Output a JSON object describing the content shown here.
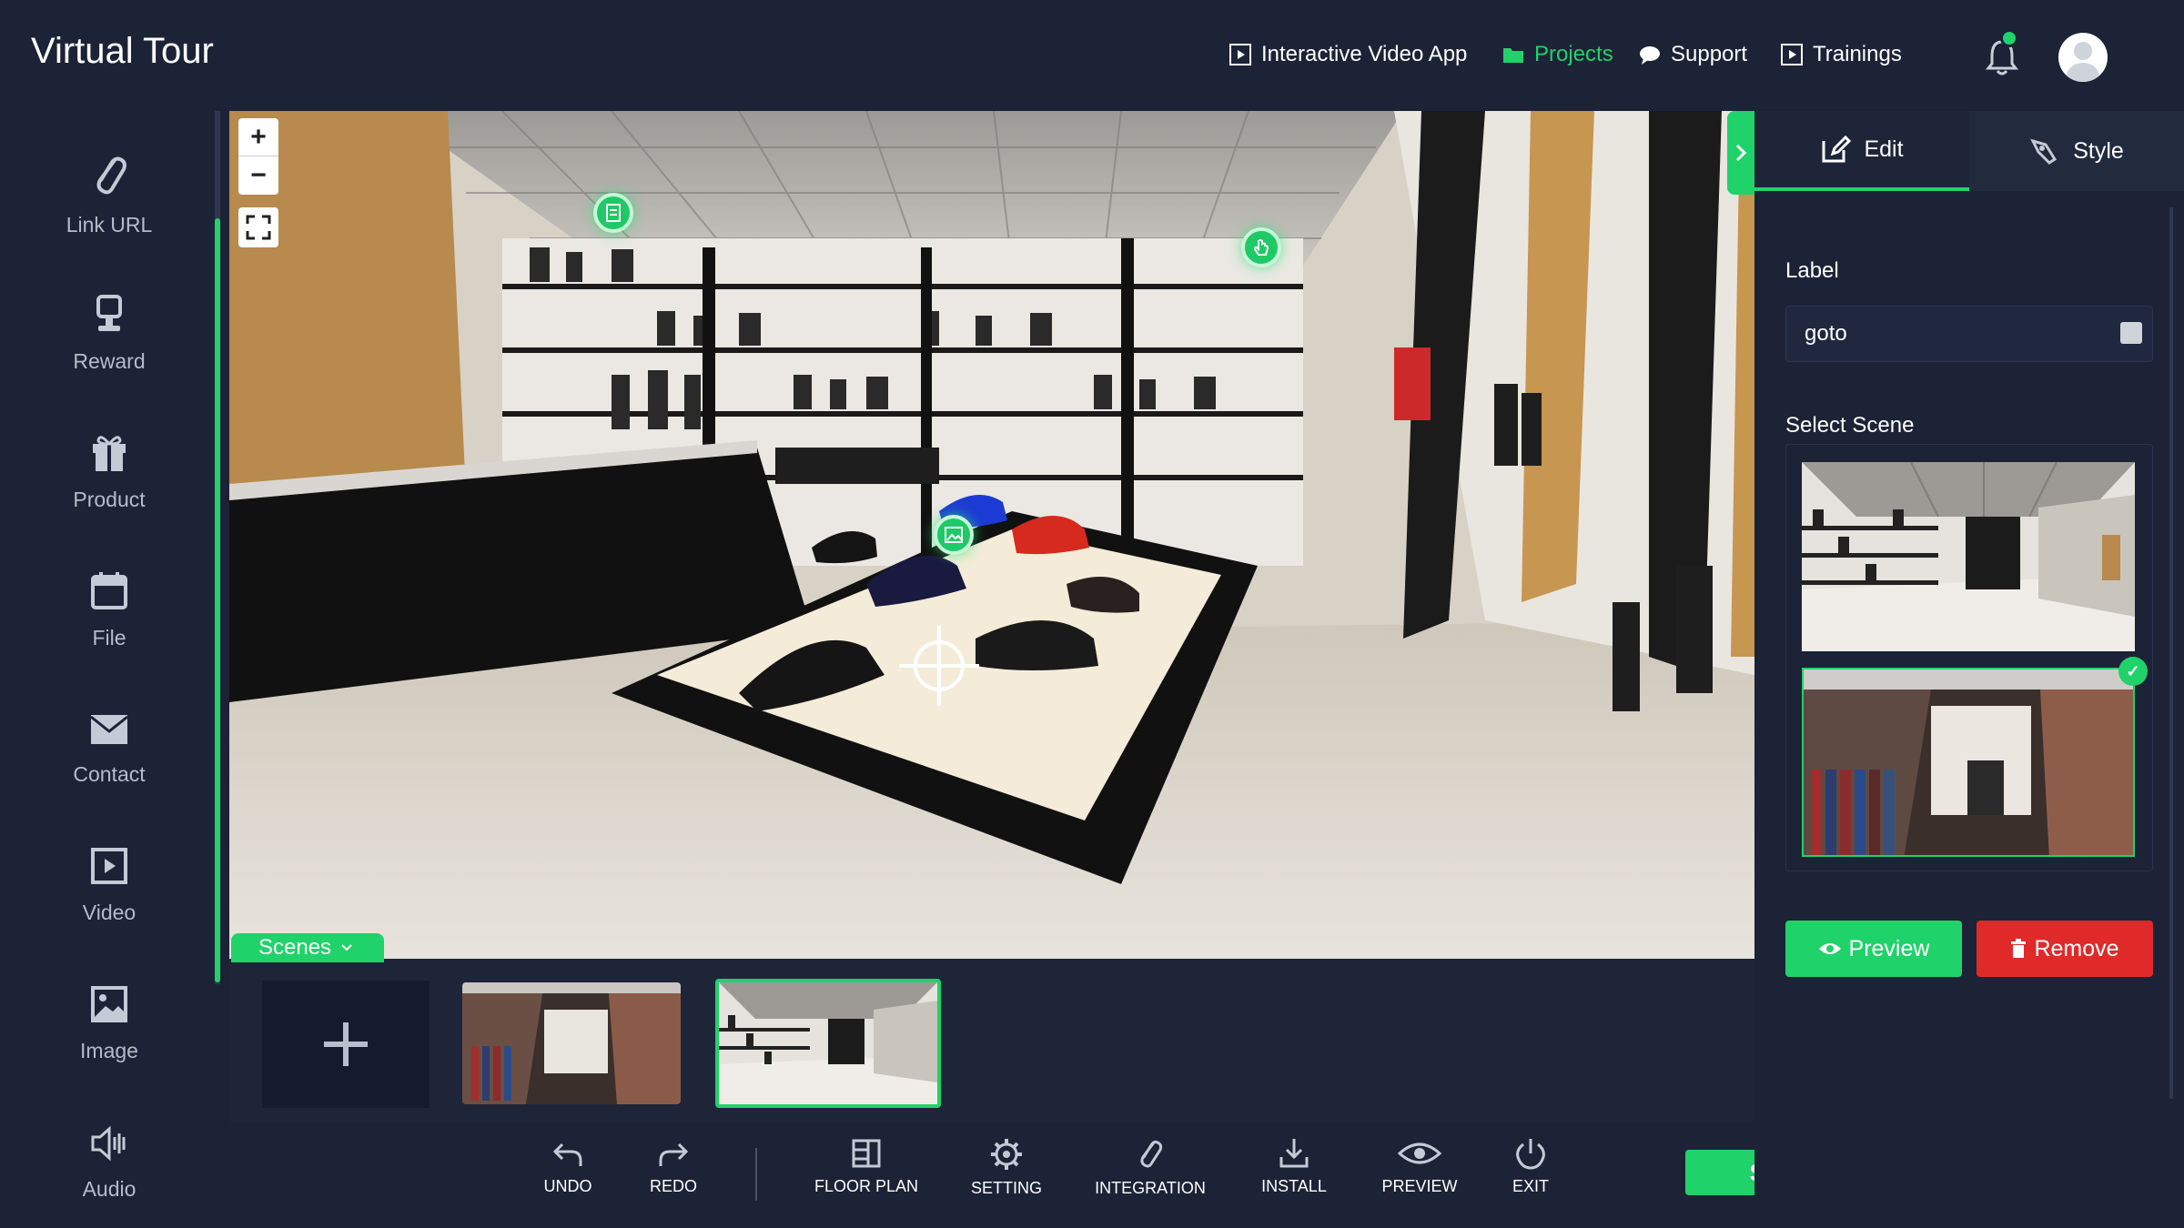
{
  "app": {
    "title": "Virtual Tour"
  },
  "topnav": {
    "items": [
      {
        "label": "Interactive Video App",
        "icon": "play-square-icon",
        "active": false
      },
      {
        "label": "Projects",
        "icon": "folder-icon",
        "active": true
      },
      {
        "label": "Support",
        "icon": "chat-bubble-icon",
        "active": false
      },
      {
        "label": "Trainings",
        "icon": "play-square-icon",
        "active": false
      }
    ],
    "notifications_icon": "bell-icon",
    "avatar_icon": "user-avatar-icon"
  },
  "sidebar": {
    "items": [
      {
        "label": "Link URL",
        "icon": "paperclip-icon"
      },
      {
        "label": "Reward",
        "icon": "trophy-icon"
      },
      {
        "label": "Product",
        "icon": "gift-icon"
      },
      {
        "label": "File",
        "icon": "calendar-icon"
      },
      {
        "label": "Contact",
        "icon": "envelope-icon"
      },
      {
        "label": "Video",
        "icon": "play-square-icon"
      },
      {
        "label": "Image",
        "icon": "image-icon"
      },
      {
        "label": "Audio",
        "icon": "speaker-icon"
      }
    ]
  },
  "viewer": {
    "zoom_in": "+",
    "zoom_out": "−",
    "hotspots": [
      "document-hotspot-icon",
      "hand-pointer-hotspot-icon",
      "image-hotspot-icon"
    ]
  },
  "scenes": {
    "tab_label": "Scenes",
    "add_label": "+"
  },
  "toolbar": {
    "tools": [
      {
        "label": "UNDO",
        "icon": "undo-icon"
      },
      {
        "label": "REDO",
        "icon": "redo-icon"
      },
      {
        "label": "FLOOR PLAN",
        "icon": "floor-plan-icon"
      },
      {
        "label": "SETTING",
        "icon": "gear-icon"
      },
      {
        "label": "INTEGRATION",
        "icon": "paperclip-icon"
      },
      {
        "label": "INSTALL",
        "icon": "download-icon"
      },
      {
        "label": "PREVIEW",
        "icon": "eye-icon"
      },
      {
        "label": "EXIT",
        "icon": "power-icon"
      }
    ],
    "save_label": "Save"
  },
  "panel": {
    "tabs": [
      {
        "label": "Edit",
        "icon": "edit-icon",
        "active": true
      },
      {
        "label": "Style",
        "icon": "brush-icon",
        "active": false
      }
    ],
    "label_title": "Label",
    "label_value": "goto",
    "select_scene_title": "Select Scene",
    "selected_scene_index": 1,
    "preview_label": "Preview",
    "remove_label": "Remove"
  },
  "colors": {
    "accent": "#20d26a",
    "danger": "#e02a2a",
    "background": "#1c2336"
  }
}
